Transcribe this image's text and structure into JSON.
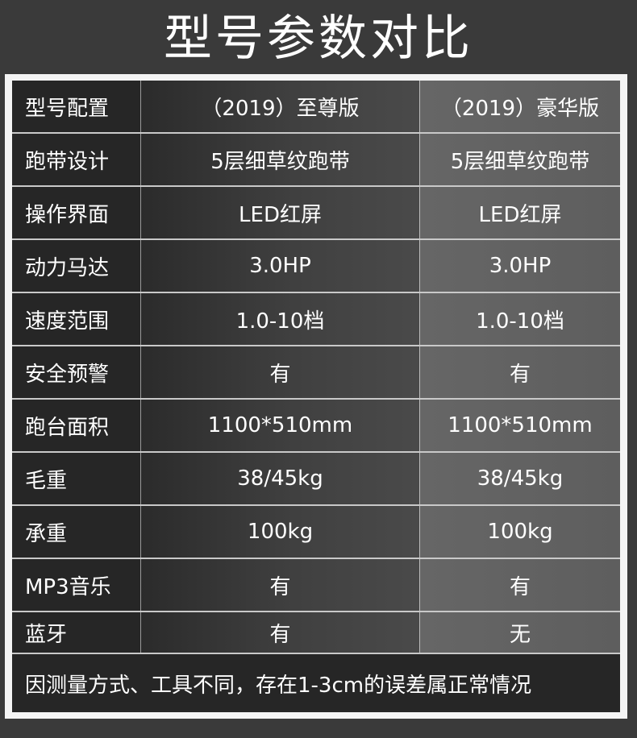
{
  "title": "型号参数对比",
  "table": {
    "rows": [
      {
        "label": "型号配置",
        "a": "（2019）至尊版",
        "b": "（2019）豪华版"
      },
      {
        "label": "跑带设计",
        "a": "5层细草纹跑带",
        "b": "5层细草纹跑带"
      },
      {
        "label": "操作界面",
        "a": "LED红屏",
        "b": "LED红屏"
      },
      {
        "label": "动力马达",
        "a": "3.0HP",
        "b": "3.0HP"
      },
      {
        "label": "速度范围",
        "a": "1.0-10档",
        "b": "1.0-10档"
      },
      {
        "label": "安全预警",
        "a": "有",
        "b": "有"
      },
      {
        "label": "跑台面积",
        "a": "1100*510mm",
        "b": "1100*510mm"
      },
      {
        "label": "毛重",
        "a": "38/45kg",
        "b": "38/45kg"
      },
      {
        "label": "承重",
        "a": "100kg",
        "b": "100kg"
      },
      {
        "label": "MP3音乐",
        "a": "有",
        "b": "有"
      },
      {
        "label": "蓝牙",
        "a": "有",
        "b": "无"
      }
    ],
    "note": "因测量方式、工具不同，存在1-3cm的误差属正常情况"
  },
  "colors": {
    "background": "#3a3a3a",
    "frame": "#f4f4f4",
    "label_cell": "#262626",
    "col_a": "#404040",
    "col_b": "#666666"
  }
}
